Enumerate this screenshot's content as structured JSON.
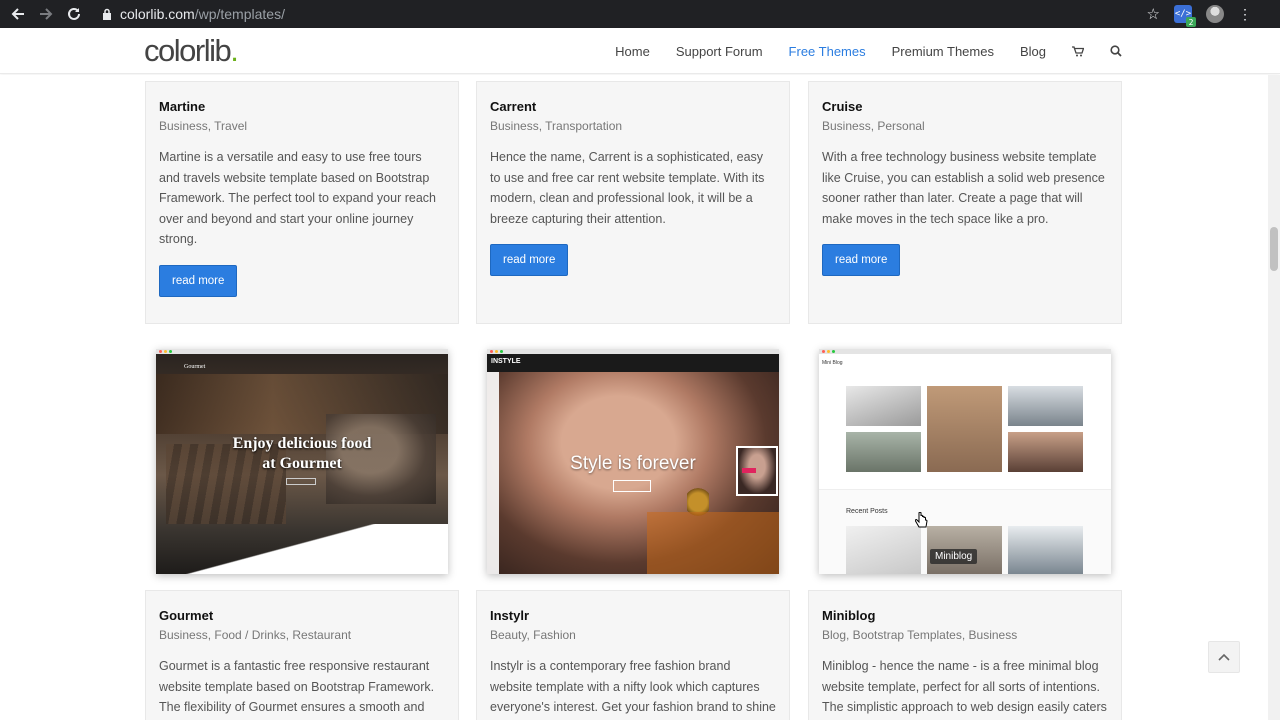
{
  "browser": {
    "url_host": "colorlib.com",
    "url_path": "/wp/templates/",
    "ext_badge": "2"
  },
  "site": {
    "logo_text": "colorlib",
    "logo_dot": ".",
    "menu": [
      {
        "label": "Home"
      },
      {
        "label": "Support Forum"
      },
      {
        "label": "Free Themes"
      },
      {
        "label": "Premium Themes"
      },
      {
        "label": "Blog"
      }
    ]
  },
  "cards_top": [
    {
      "title": "Martine",
      "cats": "Business, Travel",
      "desc": "Martine is a versatile and easy to use free tours and travels website template based on Bootstrap Framework. The perfect tool to expand your reach over and beyond and start your online journey strong.",
      "button": "read more"
    },
    {
      "title": "Carrent",
      "cats": "Business, Transportation",
      "desc": "Hence the name, Carrent is a sophisticated, easy to use and free car rent website template. With its modern, clean and professional look, it will be a breeze capturing their attention.",
      "button": "read more"
    },
    {
      "title": "Cruise",
      "cats": "Business, Personal",
      "desc": "With a free technology business website template like Cruise, you can establish a solid web presence sooner rather than later. Create a page that will make moves in the tech space like a pro.",
      "button": "read more"
    }
  ],
  "thumbs": {
    "gourmet": {
      "headline_1": "Enjoy delicious food",
      "headline_2": "at Gourmet",
      "logo": "Gourmet"
    },
    "instyle": {
      "logo": "INSTYLE",
      "headline": "Style is forever"
    },
    "miniblog": {
      "logo": "Mini Blog",
      "section": "Recent Posts",
      "tooltip": "Miniblog"
    }
  },
  "cards_bottom": [
    {
      "title": "Gourmet",
      "cats": "Business, Food / Drinks, Restaurant",
      "desc": "Gourmet is a fantastic free responsive restaurant website template based on Bootstrap Framework. The flexibility of Gourmet ensures a smooth and stable experience on all devices, smartphones"
    },
    {
      "title": "Instylr",
      "cats": "Beauty, Fashion",
      "desc": "Instylr is a contemporary free fashion brand website template with a nifty look which captures everyone's interest. Get your fashion brand to shine online with Instylr and stand out a mile"
    },
    {
      "title": "Miniblog",
      "cats": "Blog, Bootstrap Templates, Business",
      "desc": "Miniblog - hence the name - is a free minimal blog website template, perfect for all sorts of intentions. The simplistic approach to web design easily caters to all sorts of different ideas and plans you"
    }
  ],
  "colors": {
    "accent": "#2b7de0",
    "logo_dot": "#6bb01a",
    "chrome": "#202124"
  }
}
